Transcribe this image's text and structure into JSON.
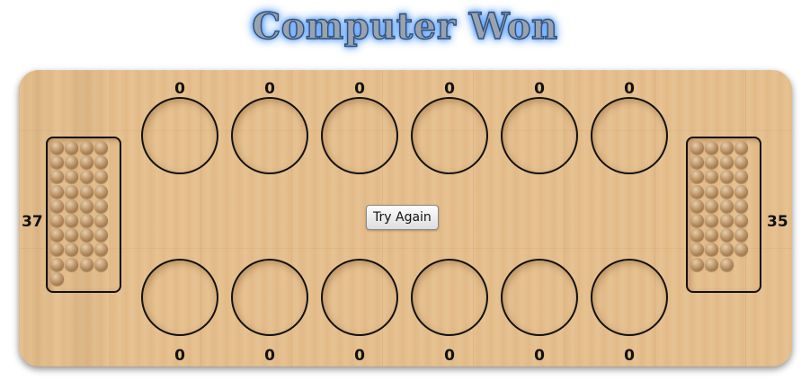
{
  "title": "Computer Won",
  "try_again_label": "Try Again",
  "stores": {
    "left": {
      "count": "37",
      "stones": 37
    },
    "right": {
      "count": "35",
      "stones": 35
    }
  },
  "top_pits": [
    "0",
    "0",
    "0",
    "0",
    "0",
    "0"
  ],
  "bottom_pits": [
    "0",
    "0",
    "0",
    "0",
    "0",
    "0"
  ],
  "colors": {
    "board": "#e3bb87",
    "outline": "#111111",
    "title_glow": "#3b87ef"
  }
}
